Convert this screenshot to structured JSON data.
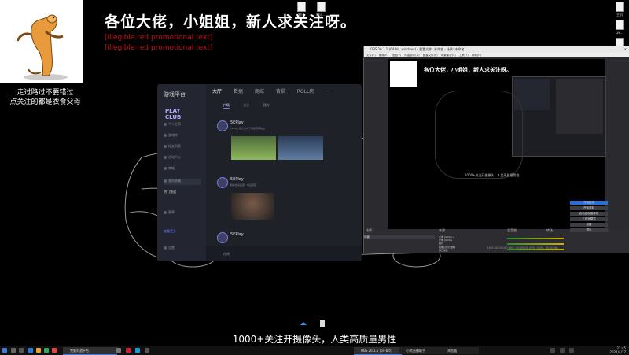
{
  "overlay": {
    "caption_line1": "走过路过不要错过",
    "caption_line2": "点关注的都是衣食父母",
    "title": "各位大佬，小姐姐，新人求关注呀。",
    "line1": "[illegible red promotional text]",
    "line2": "[illegible red promotional text]",
    "subtitle": "1000+关注开摄像头，人类高质量男性"
  },
  "desktop_icons": [
    {
      "label": "腾讯"
    },
    {
      "label": "腾讯..."
    },
    {
      "label": "主机"
    },
    {
      "label": "GE..."
    },
    {
      "label": "文档"
    }
  ],
  "game_app": {
    "logo": "游戏平台",
    "play_button": "PLAY CLUB",
    "nav_tabs": [
      "大厅",
      "数据",
      "商城",
      "背景",
      "ROLL房",
      "···"
    ],
    "sub_tabs": [
      "广场",
      "关注",
      "我的"
    ],
    "sidebar_items": [
      "个人主页",
      "游戏库",
      "好友列表",
      "活动中心",
      "商城",
      "我的收藏",
      "赛事",
      "设置"
    ],
    "section_label": "热门频道",
    "section_button": "查看更多",
    "posts": [
      {
        "name": "5EPlay",
        "text": "5EPlay 官方发布了最新赛事动态"
      },
      {
        "name": "5EPlay",
        "text": "精彩击杀集锦，快来围观"
      },
      {
        "name": "5EPlay",
        "text": ""
      }
    ],
    "footer_text": "在线"
  },
  "obs": {
    "title": "OBS 26.1.1 (64-bit, windows) - 配置文件: 未命名 - 场景: 未命名",
    "menu": [
      "文件(F)",
      "编辑(E)",
      "视图(V)",
      "停靠部件(D)",
      "配置文件(P)",
      "场景集合(S)",
      "工具(T)",
      "帮助(H)"
    ],
    "preview_title": "各位大佬，小姐姐，新人求关注呀。",
    "preview_caption": "1000+关注开摄像头，人类高质量男性",
    "docks": [
      "场景",
      "来源",
      "混音器",
      "转场",
      "控件"
    ],
    "scene": "场景",
    "sources": [
      "文本 (GDI+) 2",
      "文本 (GDI+)",
      "图片",
      "图像幻灯片放映",
      "窗口采集",
      "浏览器",
      "视频采集设备",
      "显示器采集"
    ],
    "controls": [
      "开始推流",
      "开始录制",
      "启动虚拟摄像机",
      "工作室模式",
      "设置",
      "退出"
    ],
    "status": "LIVE: 00:00:00  REC: 00:00:00  CPU: 3.4%, 30.00 fps"
  },
  "taskbar": {
    "apps": [
      {
        "label": "完美对战平台",
        "active": true
      },
      {
        "label": "OBS 26.1.1 (64-bit)",
        "active": true
      },
      {
        "label": "小黑直播助手",
        "active": false
      },
      {
        "label": "浏览器",
        "active": false
      }
    ],
    "time": "21:45",
    "date": "2021/4/17"
  },
  "colors": {
    "accent": "#6a72ff",
    "banner_red": "#c4121a",
    "obs_live": "#2a6fd6"
  }
}
